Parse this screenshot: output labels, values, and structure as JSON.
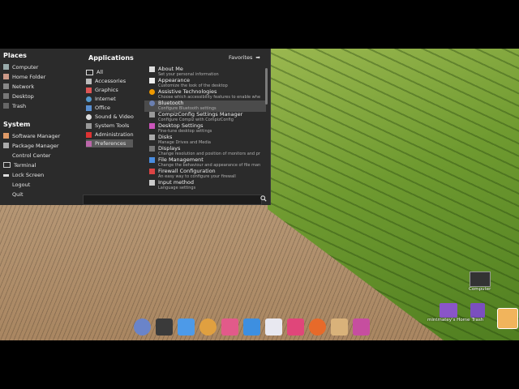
{
  "places": {
    "title": "Places",
    "items": [
      {
        "label": "Computer",
        "icon": "computer-icon"
      },
      {
        "label": "Home Folder",
        "icon": "home-folder-icon"
      },
      {
        "label": "Network",
        "icon": "network-icon"
      },
      {
        "label": "Desktop",
        "icon": "desktop-icon"
      },
      {
        "label": "Trash",
        "icon": "trash-icon"
      }
    ]
  },
  "system": {
    "title": "System",
    "items": [
      {
        "label": "Software Manager",
        "icon": "software-manager-icon"
      },
      {
        "label": "Package Manager",
        "icon": "package-manager-icon"
      },
      {
        "label": "Control Center",
        "icon": "control-center-icon"
      },
      {
        "label": "Terminal",
        "icon": "terminal-icon"
      },
      {
        "label": "Lock Screen",
        "icon": "lock-icon"
      },
      {
        "label": "Logout",
        "icon": "logout-icon"
      },
      {
        "label": "Quit",
        "icon": "quit-icon"
      }
    ]
  },
  "applications": {
    "title": "Applications",
    "favorites_label": "Favorites",
    "categories": [
      "All",
      "Accessories",
      "Graphics",
      "Internet",
      "Office",
      "Sound & Video",
      "System Tools",
      "Administration",
      "Preferences"
    ],
    "selected_category": "Preferences",
    "apps": [
      {
        "name": "About Me",
        "desc": "Set your personal information"
      },
      {
        "name": "Appearance",
        "desc": "Customize the look of the desktop"
      },
      {
        "name": "Assistive Technologies",
        "desc": "Choose which accessibility features to enable whe..."
      },
      {
        "name": "Bluetooth",
        "desc": "Configure Bluetooth settings"
      },
      {
        "name": "CompizConfig Settings Manager",
        "desc": "Configure Compiz with CompizConfig"
      },
      {
        "name": "Desktop Settings",
        "desc": "Fine-tune desktop settings"
      },
      {
        "name": "Disks",
        "desc": "Manage Drives and Media"
      },
      {
        "name": "Displays",
        "desc": "Change resolution and position of monitors and pr..."
      },
      {
        "name": "File Management",
        "desc": "Change the behaviour and appearance of file manage..."
      },
      {
        "name": "Firewall Configuration",
        "desc": "An easy way to configure your firewall"
      },
      {
        "name": "Input method",
        "desc": "Language settings"
      }
    ],
    "selected_app": "Bluetooth"
  },
  "desktop_icons": [
    {
      "label": "Computer",
      "icon": "computer-icon"
    },
    {
      "label": "mintmatey's Home",
      "icon": "home-folder-icon"
    },
    {
      "label": "Trash",
      "icon": "trash-icon"
    }
  ],
  "dock": [
    "mintmenu-icon",
    "terminal-icon",
    "text-editor-icon",
    "audio-icon",
    "app-icon",
    "folder-icon",
    "document-icon",
    "app-icon",
    "firefox-icon",
    "eye-icon",
    "window-icon"
  ],
  "colors": {
    "accent": "#5a5a5a",
    "menu_bg": "#2b2b2b"
  }
}
